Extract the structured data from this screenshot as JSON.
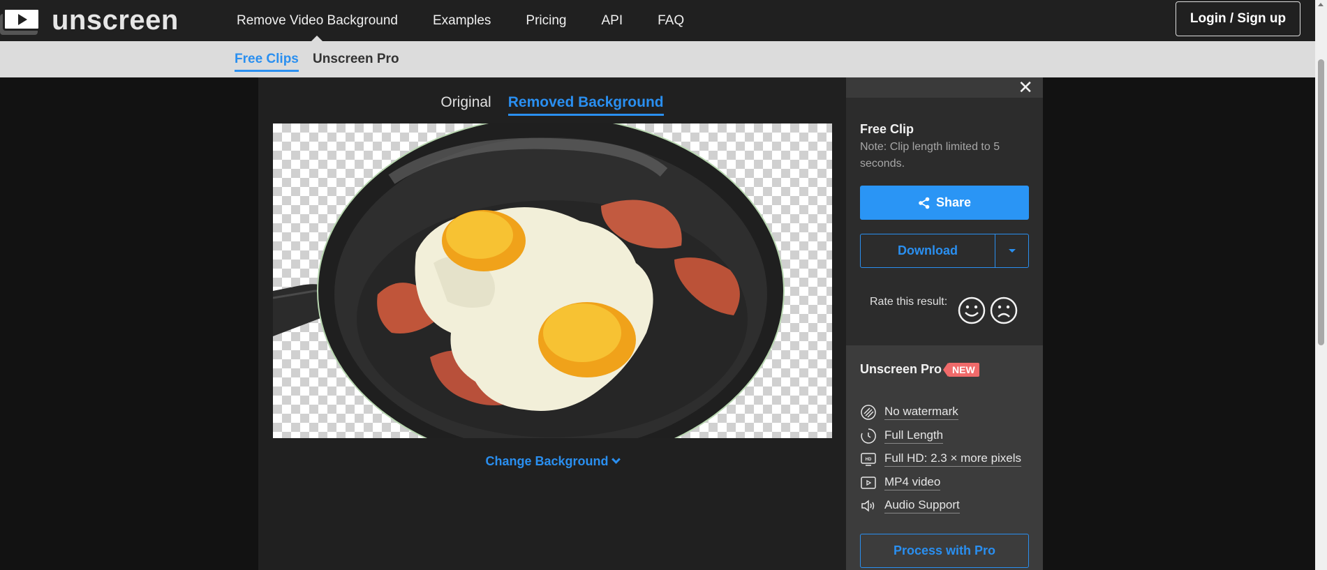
{
  "header": {
    "logo_text": "unscreen",
    "nav": [
      {
        "label": "Remove Video Background",
        "active": true
      },
      {
        "label": "Examples"
      },
      {
        "label": "Pricing"
      },
      {
        "label": "API"
      },
      {
        "label": "FAQ"
      }
    ],
    "login_label": "Login / Sign up"
  },
  "subnav": {
    "items": [
      {
        "label": "Free Clips",
        "active": true
      },
      {
        "label": "Unscreen Pro"
      }
    ]
  },
  "viewer": {
    "tabs": [
      {
        "label": "Original"
      },
      {
        "label": "Removed Background",
        "active": true
      }
    ],
    "change_background_label": "Change Background",
    "image_alt": "Frying pan with two fried eggs and bacon, background removed"
  },
  "sidebar": {
    "close_icon": "close-icon",
    "free_title": "Free Clip",
    "free_note": "Note: Clip length limited to 5 seconds.",
    "share_label": "Share",
    "download_label": "Download",
    "rate_label": "Rate this result:",
    "pro": {
      "title": "Unscreen Pro",
      "badge": "NEW",
      "features": [
        {
          "icon": "no-watermark-icon",
          "label": "No watermark"
        },
        {
          "icon": "clock-icon",
          "label": "Full Length"
        },
        {
          "icon": "hd-icon",
          "label": "Full HD: 2.3 × more pixels"
        },
        {
          "icon": "play-file-icon",
          "label": "MP4 video"
        },
        {
          "icon": "speaker-icon",
          "label": "Audio Support"
        }
      ],
      "process_label": "Process with Pro"
    }
  },
  "colors": {
    "accent": "#2a8ff0",
    "share_button": "#2a95f5",
    "new_badge": "#f06a6a",
    "page_bg": "#121212",
    "panel_bg": "#202020"
  }
}
